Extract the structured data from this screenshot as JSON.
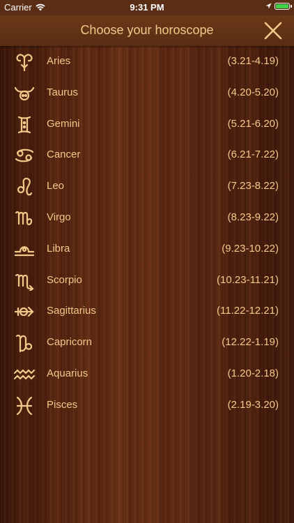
{
  "status": {
    "carrier": "Carrier",
    "time": "9:31 PM"
  },
  "header": {
    "title": "Choose your horoscope",
    "close_icon": "close-icon"
  },
  "colors": {
    "accent": "#f3c98b",
    "nav_background": "#5a2d13",
    "battery": "#3ed14a"
  },
  "signs": [
    {
      "name": "Aries",
      "dates": "(3.21-4.19)",
      "icon": "aries-icon"
    },
    {
      "name": "Taurus",
      "dates": "(4.20-5.20)",
      "icon": "taurus-icon"
    },
    {
      "name": "Gemini",
      "dates": "(5.21-6.20)",
      "icon": "gemini-icon"
    },
    {
      "name": "Cancer",
      "dates": "(6.21-7.22)",
      "icon": "cancer-icon"
    },
    {
      "name": "Leo",
      "dates": "(7.23-8.22)",
      "icon": "leo-icon"
    },
    {
      "name": "Virgo",
      "dates": "(8.23-9.22)",
      "icon": "virgo-icon"
    },
    {
      "name": "Libra",
      "dates": "(9.23-10.22)",
      "icon": "libra-icon"
    },
    {
      "name": "Scorpio",
      "dates": "(10.23-11.21)",
      "icon": "scorpio-icon"
    },
    {
      "name": "Sagittarius",
      "dates": "(11.22-12.21)",
      "icon": "sagittarius-icon"
    },
    {
      "name": "Capricorn",
      "dates": "(12.22-1.19)",
      "icon": "capricorn-icon"
    },
    {
      "name": "Aquarius",
      "dates": "(1.20-2.18)",
      "icon": "aquarius-icon"
    },
    {
      "name": "Pisces",
      "dates": "(2.19-3.20)",
      "icon": "pisces-icon"
    }
  ]
}
